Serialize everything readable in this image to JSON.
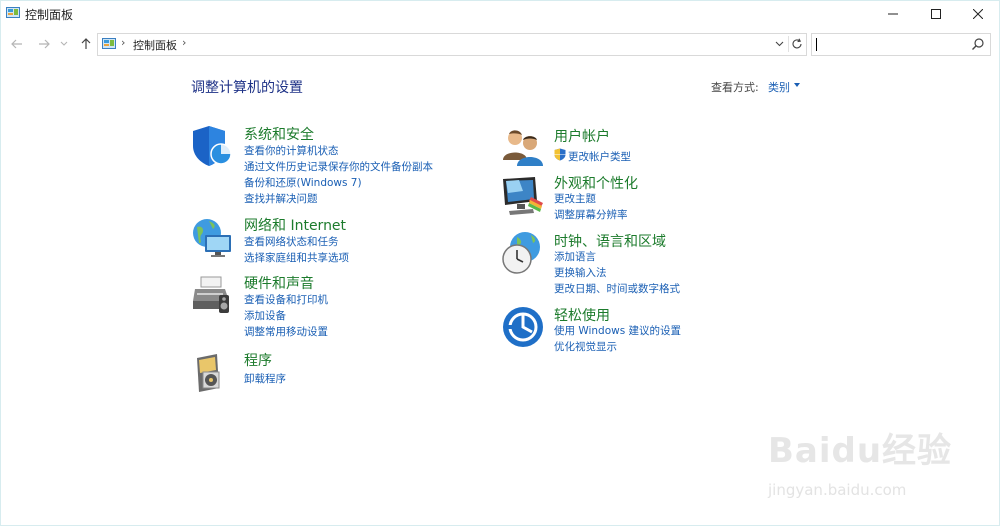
{
  "window": {
    "title": "控制面板"
  },
  "addressbar": {
    "path": "控制面板"
  },
  "search": {
    "placeholder": ""
  },
  "main": {
    "heading": "调整计算机的设置",
    "view_by_label": "查看方式:",
    "view_by_value": "类别"
  },
  "categories": {
    "system": {
      "title": "系统和安全",
      "links": [
        "查看你的计算机状态",
        "通过文件历史记录保存你的文件备份副本",
        "备份和还原(Windows 7)",
        "查找并解决问题"
      ]
    },
    "network": {
      "title": "网络和 Internet",
      "links": [
        "查看网络状态和任务",
        "选择家庭组和共享选项"
      ]
    },
    "hardware": {
      "title": "硬件和声音",
      "links": [
        "查看设备和打印机",
        "添加设备",
        "调整常用移动设置"
      ]
    },
    "programs": {
      "title": "程序",
      "links": [
        "卸载程序"
      ]
    },
    "users": {
      "title": "用户帐户",
      "links": [
        "更改帐户类型"
      ]
    },
    "appearance": {
      "title": "外观和个性化",
      "links": [
        "更改主题",
        "调整屏幕分辨率"
      ]
    },
    "clock": {
      "title": "时钟、语言和区域",
      "links": [
        "添加语言",
        "更换输入法",
        "更改日期、时间或数字格式"
      ]
    },
    "ease": {
      "title": "轻松使用",
      "links": [
        "使用 Windows 建议的设置",
        "优化视觉显示"
      ]
    }
  },
  "watermark": {
    "logo": "Baidu经验",
    "url": "jingyan.baidu.com"
  },
  "colors": {
    "category_title": "#1c7b2c",
    "link": "#1a5fb4",
    "heading": "#1e3287"
  }
}
